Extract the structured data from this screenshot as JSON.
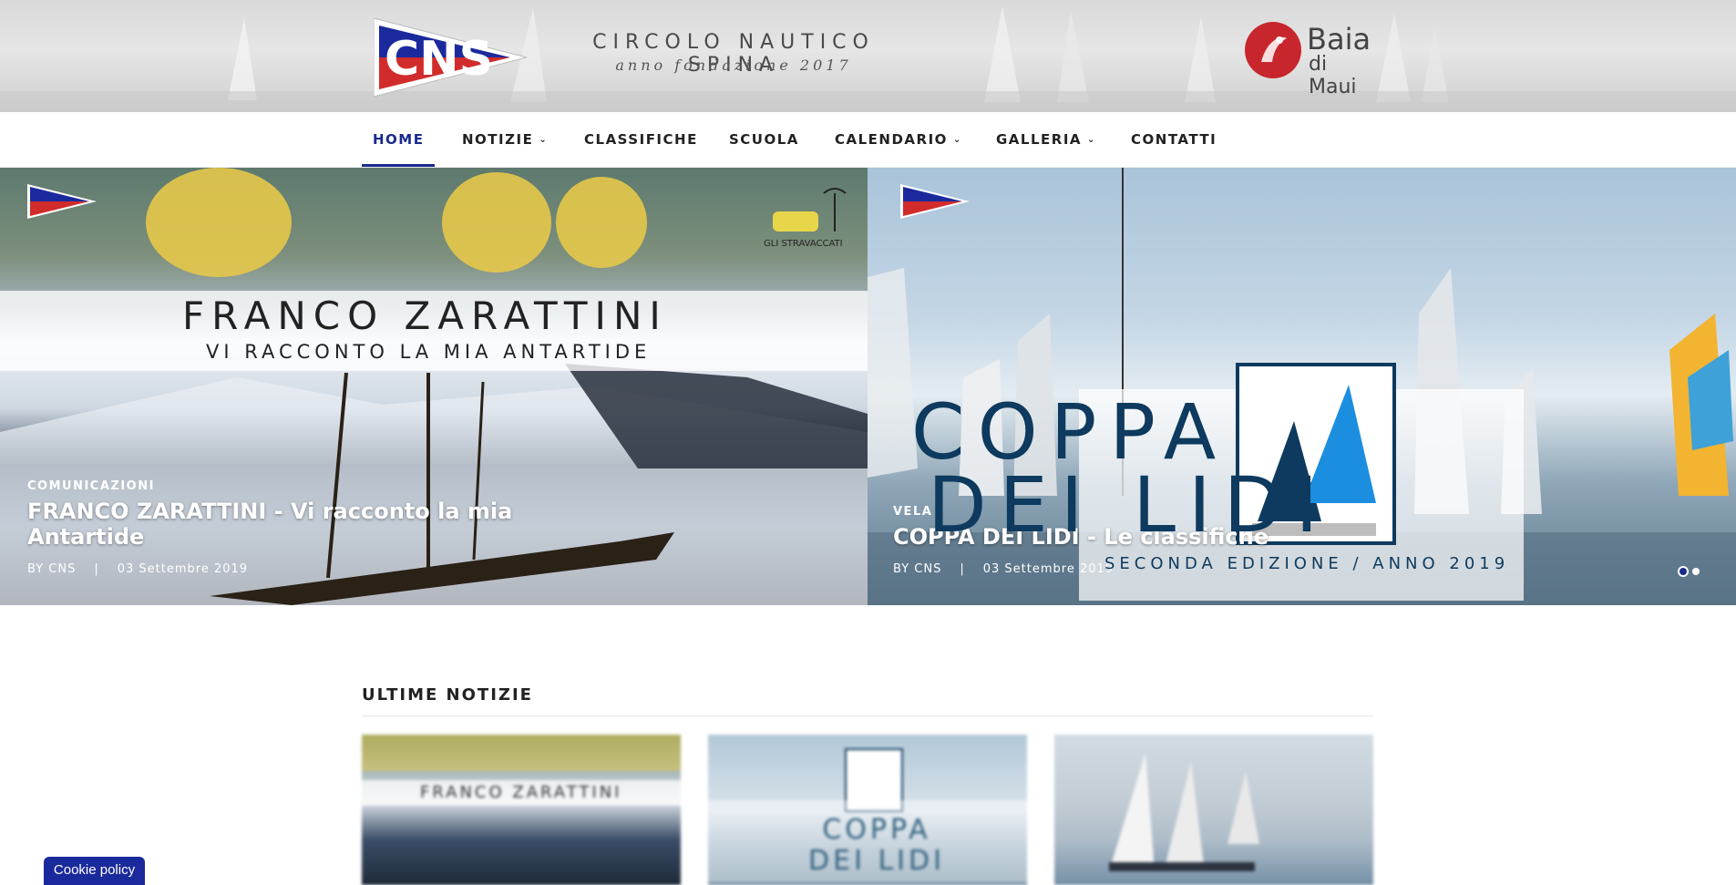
{
  "header": {
    "club_name": "CIRCOLO NAUTICO SPINA",
    "club_subtitle": "anno fondazione 2017",
    "logo_text": "CNS",
    "sponsor_name": "Baia",
    "sponsor_sub": "di Maui"
  },
  "nav": {
    "items": [
      {
        "label": "HOME",
        "active": true,
        "dropdown": false
      },
      {
        "label": "NOTIZIE",
        "dropdown": true
      },
      {
        "label": "CLASSIFICHE",
        "dropdown": false
      },
      {
        "label": "SCUOLA",
        "dropdown": false
      },
      {
        "label": "CALENDARIO",
        "dropdown": true
      },
      {
        "label": "GALLERIA",
        "dropdown": true
      },
      {
        "label": "CONTATTI",
        "dropdown": false
      }
    ],
    "chevron": "⌄"
  },
  "slides": [
    {
      "category": "COMUNICAZIONI",
      "title": "FRANCO ZARATTINI - Vi racconto la mia Antartide",
      "author": "BY CNS",
      "date": "03 Settembre 2019",
      "image_title": "FRANCO ZARATTINI",
      "image_subtitle": "VI RACCONTO LA MIA ANTARTIDE",
      "badge": "GLI STRAVACCATI"
    },
    {
      "category": "VELA",
      "title": "COPPA DEI LIDI - Le classifiche",
      "author": "BY CNS",
      "date": "03 Settembre 2019",
      "image_line1": "COPPA",
      "image_line2": "DEI LIDI",
      "image_line3": "SECONDA EDIZIONE / ANNO 2019"
    }
  ],
  "separator": "|",
  "latest": {
    "title": "ULTIME NOTIZIE",
    "cards": [
      {
        "image_text": "FRANCO ZARATTINI"
      },
      {
        "image_text": "COPPA DEI LIDI"
      },
      {
        "image_text": ""
      }
    ]
  },
  "cookie": {
    "label": "Cookie policy"
  },
  "colors": {
    "accent": "#1a2a8c",
    "brand_red": "#c8262d",
    "coppa_blue": "#0d3a5e"
  }
}
